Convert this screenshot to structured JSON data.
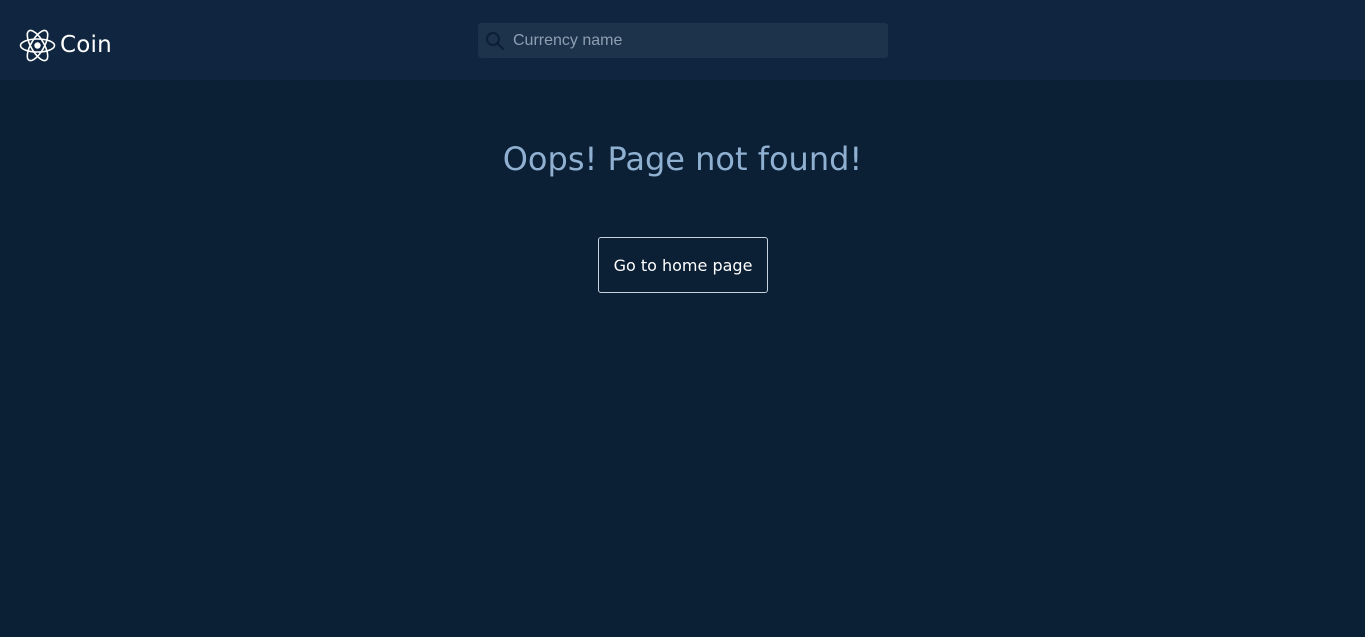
{
  "brand": {
    "name": "Coin",
    "icon": "atom-icon"
  },
  "search": {
    "placeholder": "Currency name",
    "value": "",
    "icon": "search-icon"
  },
  "error": {
    "title": "Oops! Page not found!"
  },
  "actions": {
    "home_button_label": "Go to home page"
  },
  "colors": {
    "background": "#0b1f35",
    "header": "#0f2540",
    "search_field": "#1d334b",
    "title_text": "#8fb0d1",
    "button_border": "#c7d3df"
  }
}
